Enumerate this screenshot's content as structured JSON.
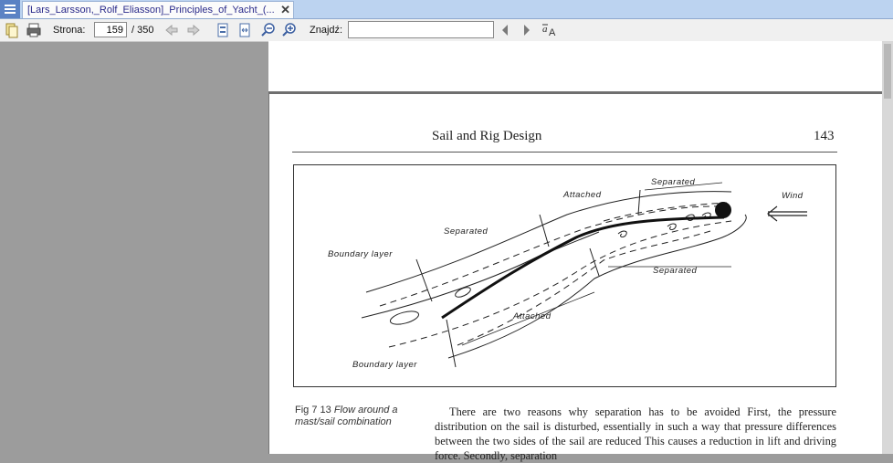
{
  "window": {
    "tab_title": "[Lars_Larsson,_Rolf_Eliasson]_Principles_of_Yacht_(...",
    "close_glyph": "✕"
  },
  "toolbar": {
    "page_label": "Strona:",
    "page_value": "159",
    "page_total": "/ 350",
    "find_label": "Znajdź:",
    "find_value": ""
  },
  "document": {
    "running_head": "Sail and Rig Design",
    "page_number": "143",
    "figure_labels": {
      "wind": "Wind",
      "separated_top": "Separated",
      "attached_top": "Attached",
      "separated_left": "Separated",
      "boundary_layer_top": "Boundary layer",
      "separated_right": "Separated",
      "attached_bottom": "Attached",
      "boundary_layer_bottom": "Boundary layer"
    },
    "caption_number": "Fig 7 13",
    "caption_text": "Flow around a mast/sail combination",
    "body_text": "There are two reasons why separation has to be avoided First, the pressure distribution on the sail is disturbed, essentially in such a way that pressure differences between the two sides of the sail are reduced This causes a reduction in lift and driving force. Secondly, separation"
  },
  "icons": [
    "menu-icon",
    "open-file-icon",
    "print-icon",
    "back-icon",
    "forward-icon",
    "fit-page-icon",
    "fit-width-icon",
    "zoom-out-icon",
    "zoom-in-icon",
    "find-prev-icon",
    "find-next-icon",
    "match-case-icon"
  ]
}
